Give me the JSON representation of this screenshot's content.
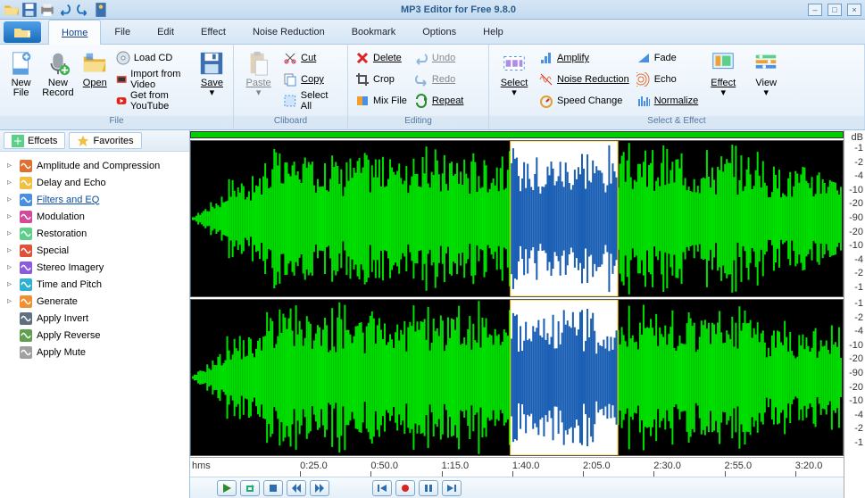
{
  "title": "MP3 Editor for Free 9.8.0",
  "menu": {
    "tabs": [
      "Home",
      "File",
      "Edit",
      "Effect",
      "Noise Reduction",
      "Bookmark",
      "Options",
      "Help"
    ],
    "active": 0
  },
  "ribbon": {
    "file": {
      "cap": "File",
      "new_file": "New File",
      "new_record": "New Record",
      "open": "Open",
      "load_cd": "Load CD",
      "import_video": "Import from Video",
      "get_youtube": "Get from YouTube",
      "save": "Save"
    },
    "clipboard": {
      "cap": "Cliboard",
      "paste": "Paste",
      "cut": "Cut",
      "copy": "Copy",
      "select_all": "Select All"
    },
    "editing": {
      "cap": "Editing",
      "delete": "Delete",
      "crop": "Crop",
      "mix": "Mix File",
      "undo": "Undo",
      "redo": "Redo",
      "repeat": "Repeat"
    },
    "selecteffect": {
      "cap": "Select & Effect",
      "select": "Select",
      "amplify": "Amplify",
      "noise": "Noise Reduction",
      "speed": "Speed Change",
      "fade": "Fade",
      "echo": "Echo",
      "normalize": "Normalize",
      "effect": "Effect",
      "view": "View"
    }
  },
  "side": {
    "tabs": {
      "effects": "Effcets",
      "favorites": "Favorites"
    },
    "tree": [
      {
        "label": "Amplitude and Compression",
        "exp": true
      },
      {
        "label": "Delay and Echo",
        "exp": true
      },
      {
        "label": "Filters and EQ",
        "exp": true,
        "sel": true
      },
      {
        "label": "Modulation",
        "exp": true
      },
      {
        "label": "Restoration",
        "exp": true
      },
      {
        "label": "Special",
        "exp": true
      },
      {
        "label": "Stereo Imagery",
        "exp": true
      },
      {
        "label": "Time and Pitch",
        "exp": true
      },
      {
        "label": "Generate",
        "exp": true
      },
      {
        "label": "Apply Invert",
        "exp": false
      },
      {
        "label": "Apply Reverse",
        "exp": false
      },
      {
        "label": "Apply Mute",
        "exp": false
      }
    ]
  },
  "timeline": {
    "unit": "hms",
    "ticks": [
      "0:25.0",
      "0:50.0",
      "1:15.0",
      "1:40.0",
      "2:05.0",
      "2:30.0",
      "2:55.0",
      "3:20.0"
    ]
  },
  "db": {
    "unit": "dB",
    "labels": [
      "-1",
      "-2",
      "-4",
      "-10",
      "-20",
      "-90",
      "-20",
      "-10",
      "-4",
      "-2",
      "-1"
    ]
  }
}
